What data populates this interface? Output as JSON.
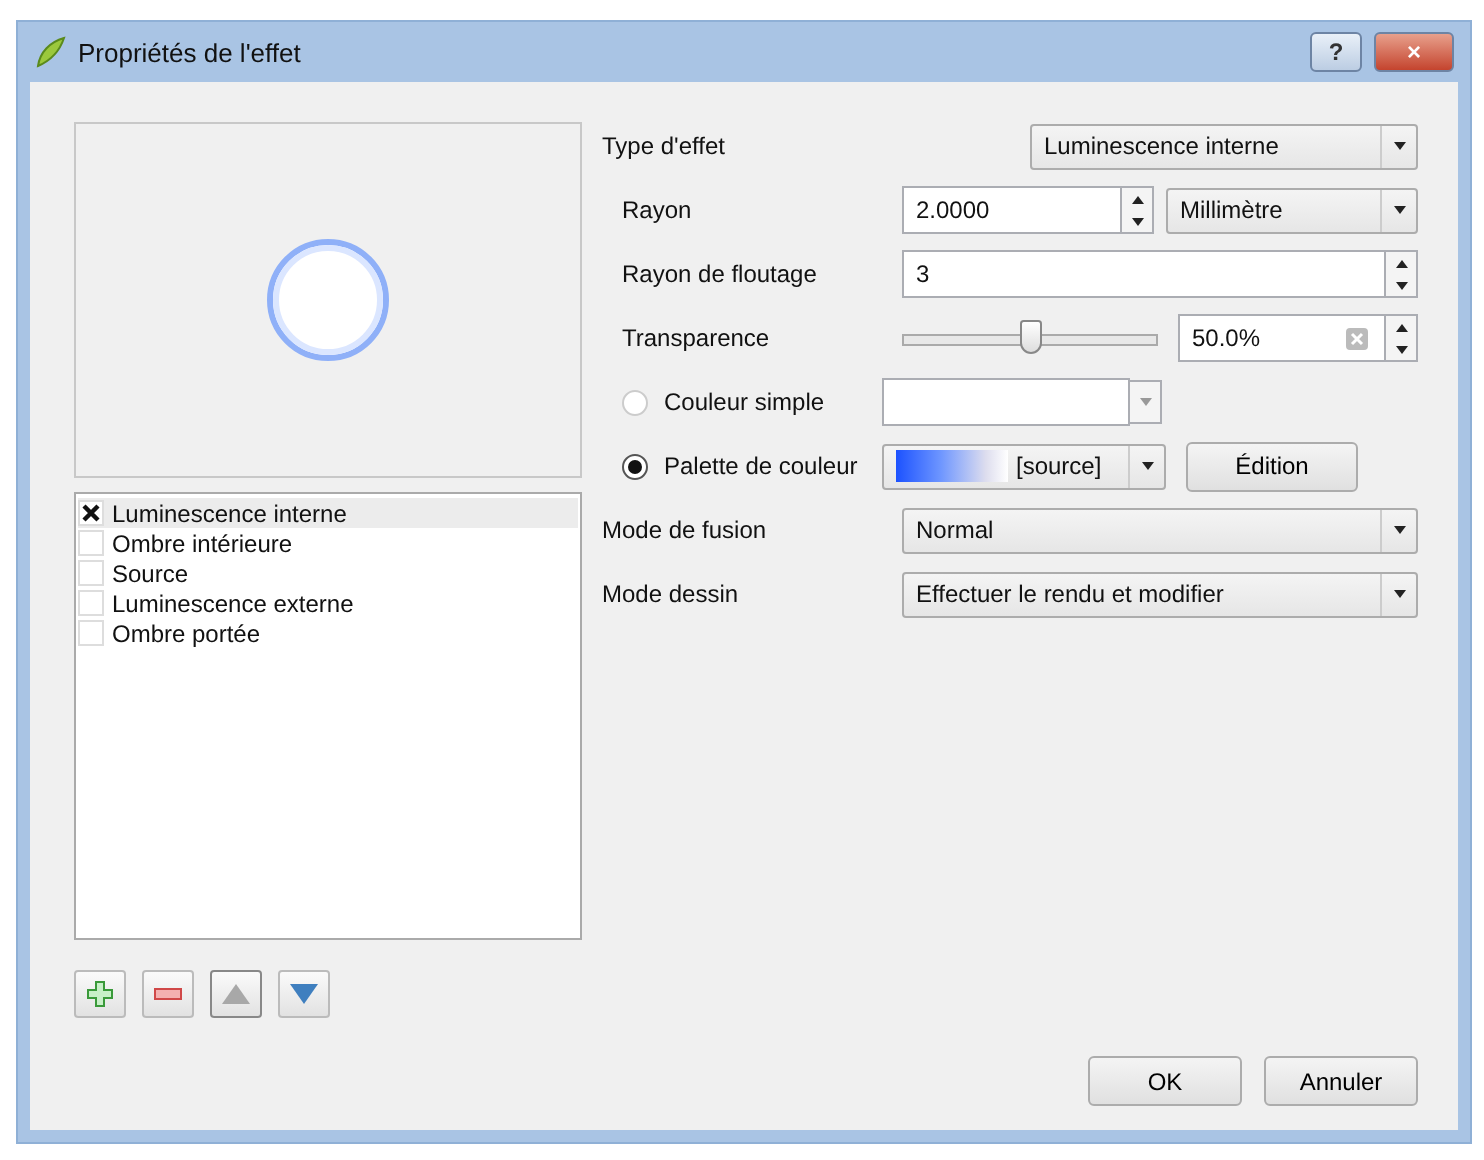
{
  "window": {
    "title": "Propriétés de l'effet",
    "help": "?",
    "close": "×"
  },
  "effects": [
    {
      "label": "Luminescence interne",
      "checked": true,
      "selected": true
    },
    {
      "label": "Ombre intérieure",
      "checked": false,
      "selected": false
    },
    {
      "label": "Source",
      "checked": false,
      "selected": false
    },
    {
      "label": "Luminescence externe",
      "checked": false,
      "selected": false
    },
    {
      "label": "Ombre portée",
      "checked": false,
      "selected": false
    }
  ],
  "tool_buttons": [
    {
      "kind": "add",
      "disabled": false
    },
    {
      "kind": "remove",
      "disabled": false
    },
    {
      "kind": "up",
      "disabled": true
    },
    {
      "kind": "down",
      "disabled": false
    }
  ],
  "effect_type": {
    "label": "Type d'effet",
    "value": "Luminescence interne"
  },
  "radius": {
    "label": "Rayon",
    "value": "2.0000",
    "unit": "Millimètre"
  },
  "blur": {
    "label": "Rayon de floutage",
    "value": "3"
  },
  "transparency": {
    "label": "Transparence",
    "level": 0.5,
    "value": "50.0%"
  },
  "color_modes": [
    {
      "label": "Couleur simple",
      "selected": false,
      "kind": "simple"
    },
    {
      "label": "Palette de couleur",
      "selected": true,
      "kind": "ramp",
      "value": "[source]",
      "button": "Édition"
    }
  ],
  "blend_mode": {
    "label": "Mode de fusion",
    "value": "Normal"
  },
  "draw_mode": {
    "label": "Mode dessin",
    "value": "Effectuer le rendu et modifier"
  },
  "buttons": [
    "OK",
    "Annuler"
  ]
}
